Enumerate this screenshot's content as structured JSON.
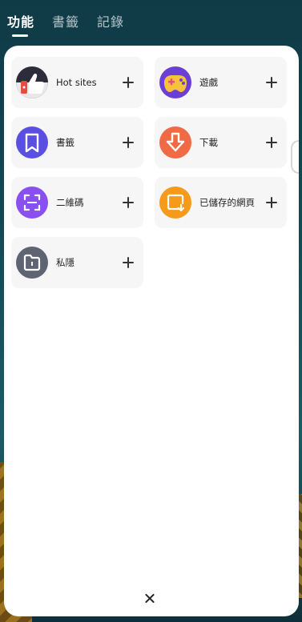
{
  "tabs": [
    {
      "label": "功能",
      "active": true
    },
    {
      "label": "書籤",
      "active": false
    },
    {
      "label": "記錄",
      "active": false
    }
  ],
  "features": [
    {
      "label": "Hot sites",
      "icon": "thumbs-up-icon"
    },
    {
      "label": "遊戲",
      "icon": "gamepad-icon"
    },
    {
      "label": "書籤",
      "icon": "bookmark-icon"
    },
    {
      "label": "下載",
      "icon": "download-icon"
    },
    {
      "label": "二維碼",
      "icon": "qr-scan-icon"
    },
    {
      "label": "已儲存的網頁",
      "icon": "saved-page-icon"
    },
    {
      "label": "私隱",
      "icon": "private-folder-icon"
    }
  ],
  "colors": {
    "bookmark": "#5a4fe0",
    "download": "#f06a45",
    "qr": "#8a4ff0",
    "saved": "#f59a1a",
    "private": "#5f6472",
    "game": "#6b3fd6"
  }
}
